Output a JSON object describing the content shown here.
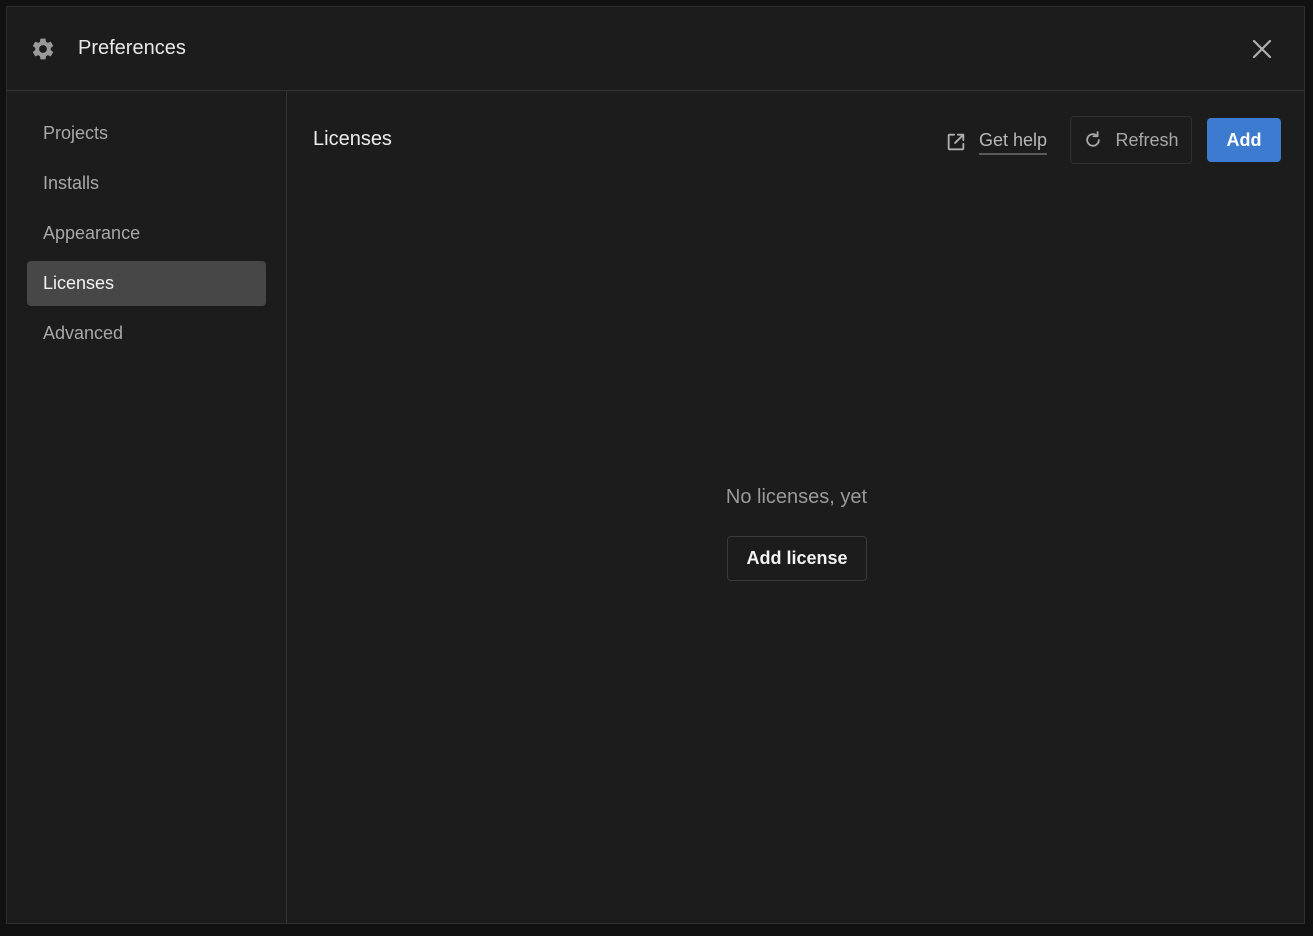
{
  "window": {
    "title": "Preferences",
    "title_icon": "gear-icon",
    "close_icon": "close-icon"
  },
  "sidebar": {
    "items": [
      {
        "label": "Projects",
        "active": false
      },
      {
        "label": "Installs",
        "active": false
      },
      {
        "label": "Appearance",
        "active": false
      },
      {
        "label": "Licenses",
        "active": true
      },
      {
        "label": "Advanced",
        "active": false
      }
    ]
  },
  "main": {
    "title": "Licenses",
    "help_label": "Get help",
    "help_icon": "external-link-icon",
    "refresh_label": "Refresh",
    "refresh_icon": "refresh-icon",
    "add_label": "Add",
    "empty_state": {
      "message": "No licenses, yet",
      "button_label": "Add license"
    }
  },
  "colors": {
    "background": "#1c1c1c",
    "accent": "#3d7bd0",
    "active_item": "#474747"
  }
}
